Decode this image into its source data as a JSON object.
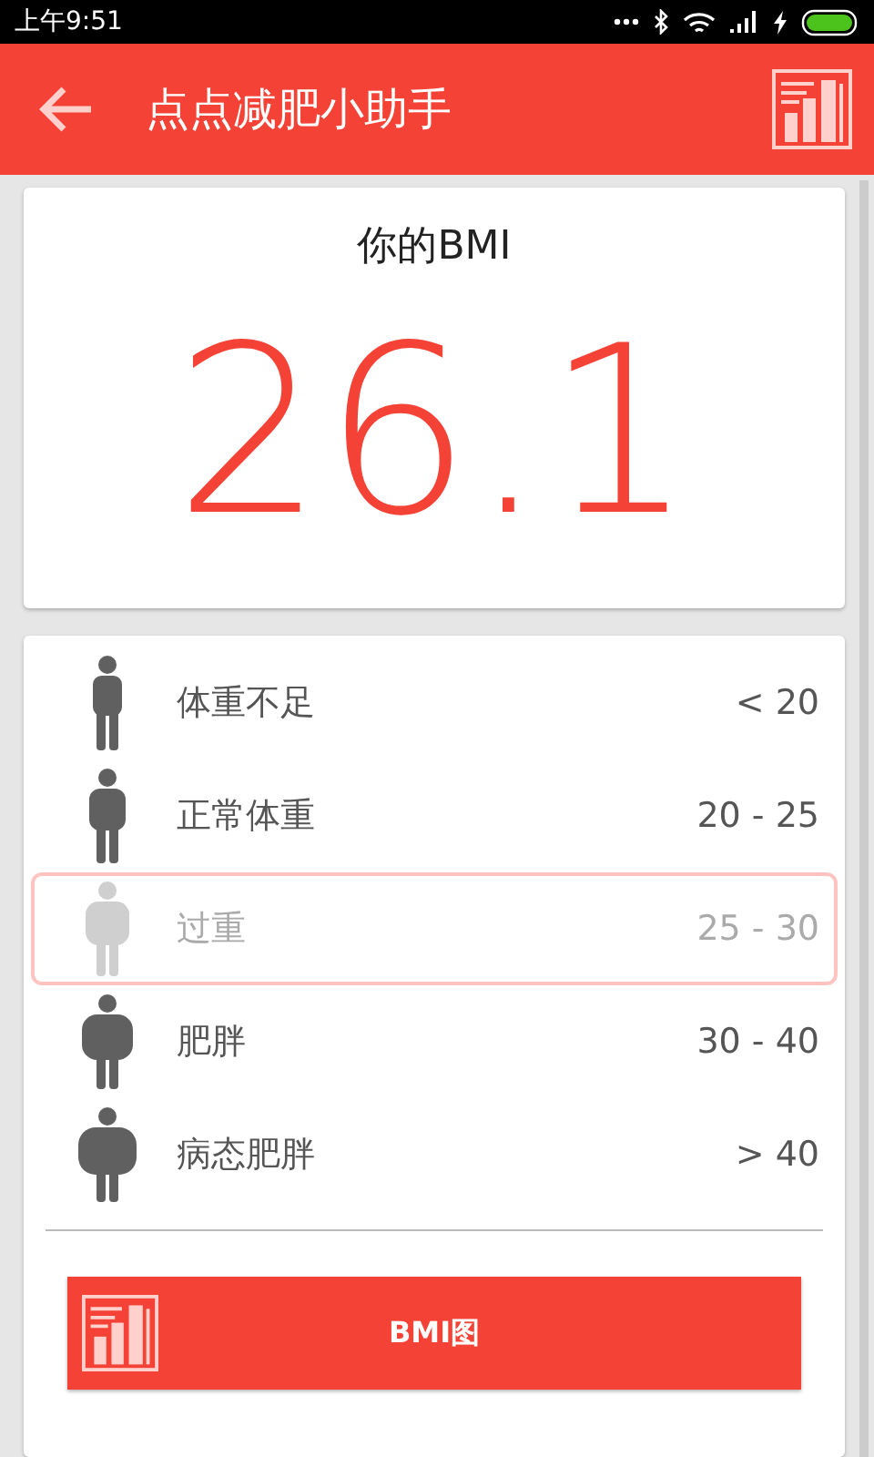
{
  "status_bar": {
    "time": "上午9:51"
  },
  "app_bar": {
    "title": "点点减肥小助手"
  },
  "bmi_card": {
    "heading": "你的BMI",
    "value": "26.1"
  },
  "categories": [
    {
      "kind": "slim",
      "label": "体重不足",
      "range": "< 20",
      "selected": false
    },
    {
      "kind": "normal",
      "label": "正常体重",
      "range": "20 - 25",
      "selected": false
    },
    {
      "kind": "overweight",
      "label": "过重",
      "range": "25 - 30",
      "selected": true
    },
    {
      "kind": "obese",
      "label": "肥胖",
      "range": "30 - 40",
      "selected": false
    },
    {
      "kind": "morbid",
      "label": "病态肥胖",
      "range": "> 40",
      "selected": false
    }
  ],
  "chart_button": {
    "label": "BMI图"
  }
}
